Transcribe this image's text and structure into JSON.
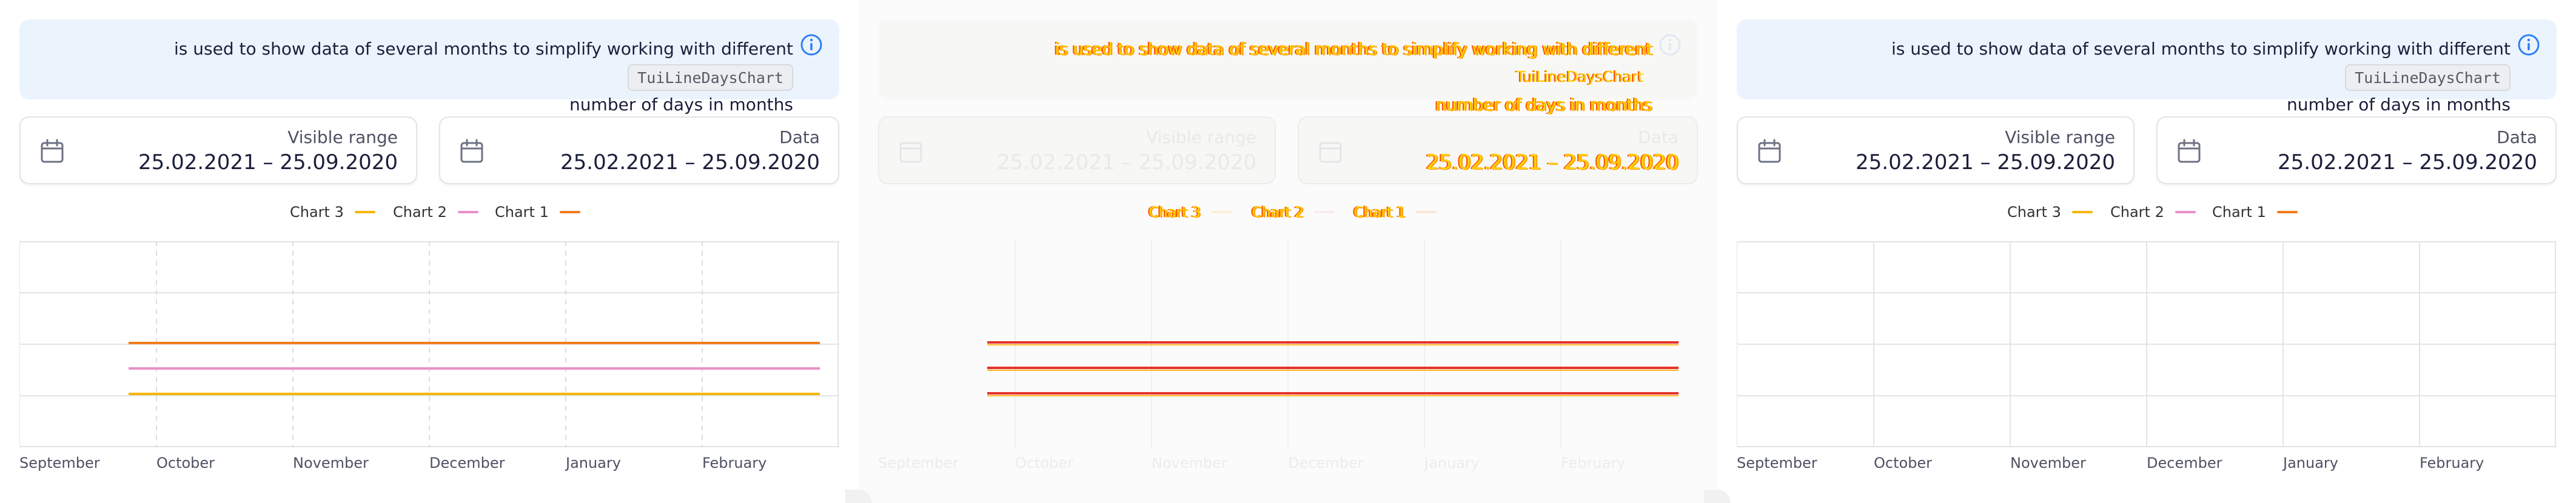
{
  "notice": {
    "text_line1": "is used to show data of several months to simplify working with different",
    "code": "TuiLineDaysChart",
    "text_line2": "number of days in months"
  },
  "visible_range": {
    "label": "Visible range",
    "value": "25.02.2021 – 25.09.2020"
  },
  "data_range": {
    "label": "Data",
    "value": "25.02.2021 – 25.09.2020"
  },
  "legend": [
    {
      "label": "Chart 3",
      "color": "#f5b50c"
    },
    {
      "label": "Chart 2",
      "color": "#e990c9"
    },
    {
      "label": "Chart 1",
      "color": "#f27c1d"
    }
  ],
  "x_ticks": [
    "September",
    "October",
    "November",
    "December",
    "January",
    "February"
  ],
  "icons": {
    "info": "info-circle-icon",
    "calendar": "calendar-icon"
  },
  "colors": {
    "accent": "#2f7ff7",
    "chart1": "#f27c1d",
    "chart2": "#e990c9",
    "chart3": "#f5b50c",
    "glitch_line": "#e5322a",
    "glitch_text": "#ffd200"
  }
}
